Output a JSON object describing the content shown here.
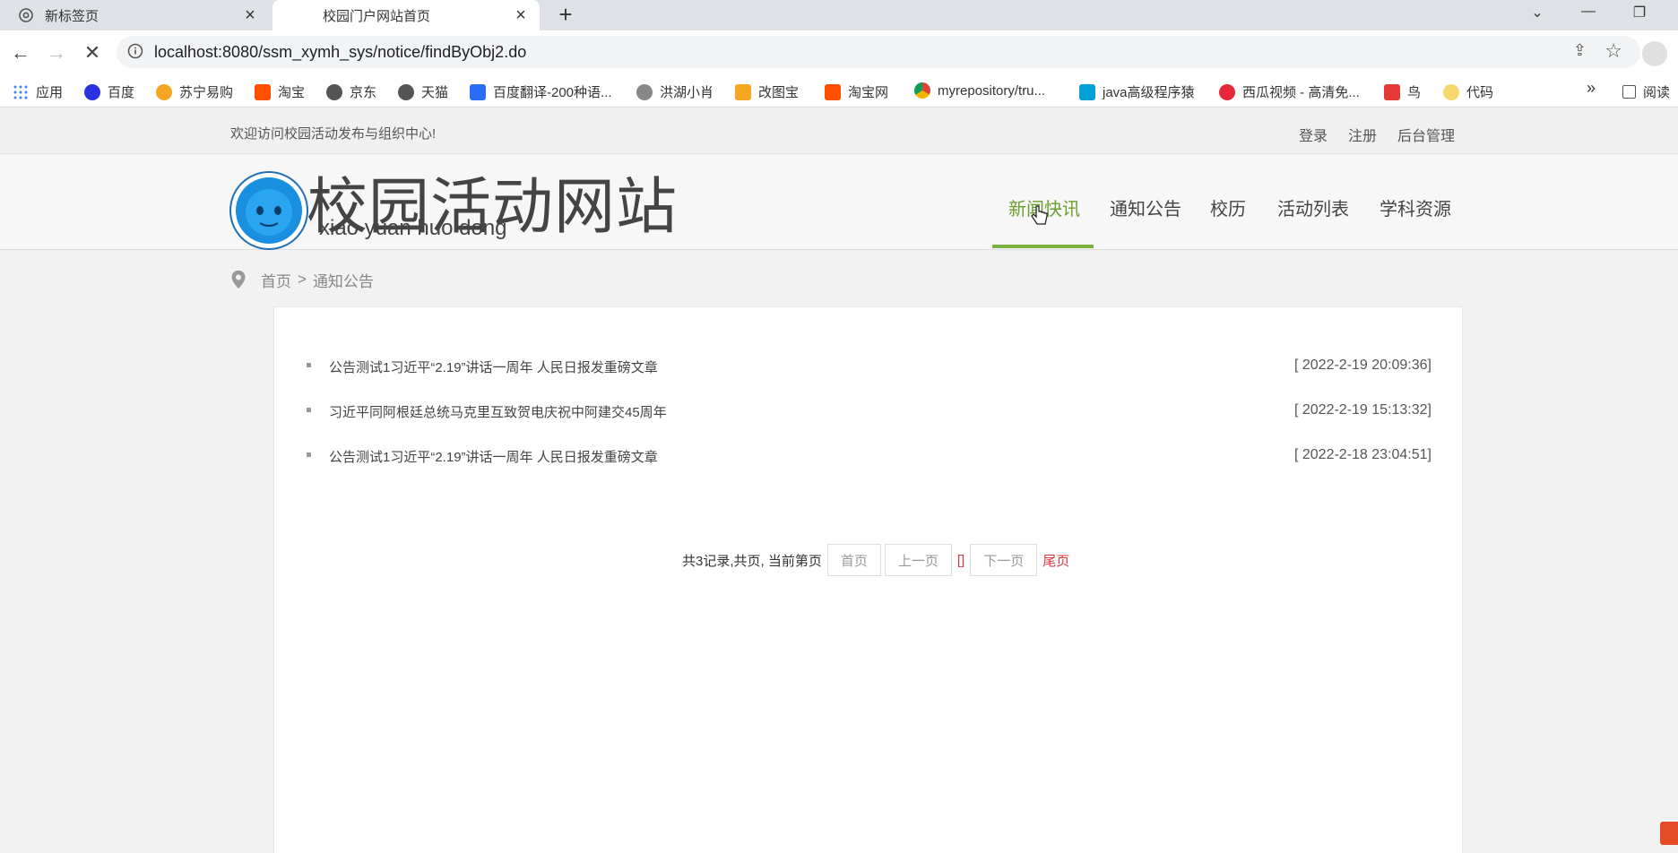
{
  "browser": {
    "tabs": [
      {
        "label": "新标签页",
        "icon": "chrome-icon"
      },
      {
        "label": "校园门户网站首页",
        "icon": "loading-icon"
      }
    ],
    "url": "localhost:8080/ssm_xymh_sys/notice/findByObj2.do",
    "bookmarks": [
      {
        "label": "应用",
        "color": "#4285f4"
      },
      {
        "label": "百度",
        "color": "#2932e1"
      },
      {
        "label": "苏宁易购",
        "color": "#f5a623"
      },
      {
        "label": "淘宝",
        "color": "#ff5000"
      },
      {
        "label": "京东",
        "color": "#555555"
      },
      {
        "label": "天猫",
        "color": "#555555"
      },
      {
        "label": "百度翻译-200种语...",
        "color": "#2b6cf5"
      },
      {
        "label": "洪湖小肖",
        "color": "#888888"
      },
      {
        "label": "改图宝",
        "color": "#f5a623"
      },
      {
        "label": "淘宝网",
        "color": "#ff5000"
      },
      {
        "label": "myrepository/tru...",
        "color": "#db4437"
      },
      {
        "label": "java高级程序猿",
        "color": "#00a1d6"
      },
      {
        "label": "西瓜视频 - 高清免...",
        "color": "#e8273a"
      },
      {
        "label": "鸟",
        "color": "#e53935"
      },
      {
        "label": "代码",
        "color": "#f5d76e"
      }
    ],
    "bookmarks_more": "»",
    "reading_list": "阅读"
  },
  "site": {
    "welcome": "欢迎访问校园活动发布与组织中心!",
    "top_links": [
      "登录",
      "注册",
      "后台管理"
    ],
    "title": "校园活动网站",
    "subtitle": "xiao yuan huo dong",
    "nav": [
      "新闻快讯",
      "通知公告",
      "校历",
      "活动列表",
      "学科资源"
    ],
    "active_nav_color": "#6b9e2f",
    "breadcrumb": {
      "home": "首页",
      "sep": ">",
      "current": "通知公告"
    }
  },
  "notices": [
    {
      "title": "公告测试1习近平“2.19”讲话一周年 人民日报发重磅文章",
      "date": "[ 2022-2-19 20:09:36]"
    },
    {
      "title": "习近平同阿根廷总统马克里互致贺电庆祝中阿建交45周年",
      "date": "[ 2022-2-19 15:13:32]"
    },
    {
      "title": "公告测试1习近平“2.19”讲话一周年 人民日报发重磅文章",
      "date": "[ 2022-2-18 23:04:51]"
    }
  ],
  "pager": {
    "summary": "共3记录,共页, 当前第页",
    "first": "首页",
    "prev": "上一页",
    "page_marker": "[]",
    "next": "下一页",
    "last": "尾页"
  }
}
